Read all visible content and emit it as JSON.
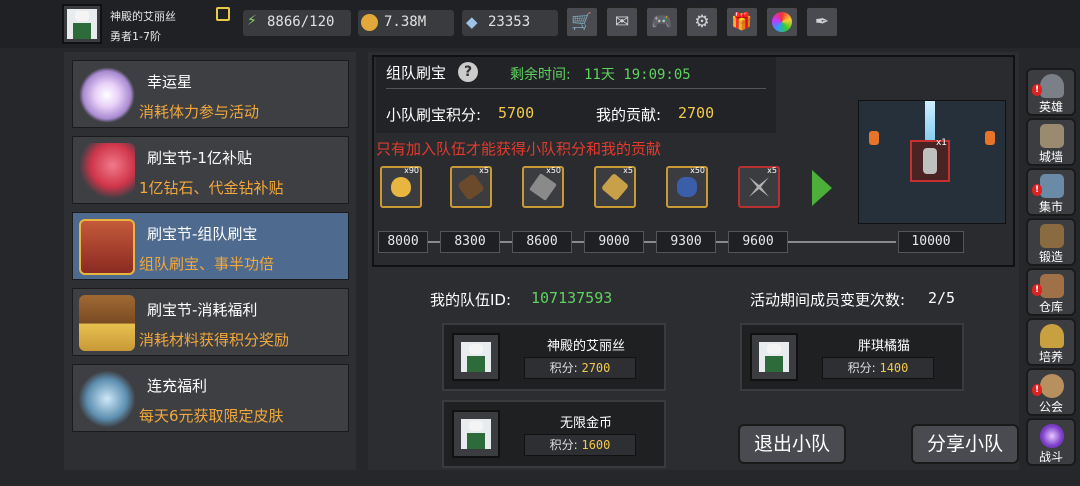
{
  "player": {
    "name": "神殿的艾丽丝",
    "rank": "勇者1-7阶"
  },
  "stats": {
    "energy": "8866/120",
    "gold": "7.38M",
    "gems": "23353"
  },
  "top_icons": [
    "cart-icon",
    "mail-icon",
    "gamepad-icon",
    "gear-icon",
    "gift-icon",
    "color-wheel-icon",
    "feather-icon"
  ],
  "menu": [
    {
      "title": "幸运星",
      "subtitle": "消耗体力参与活动",
      "icon": "lucky-star-icon",
      "color": "#c9b8e0"
    },
    {
      "title": "刷宝节-1亿补贴",
      "subtitle": "1亿钻石、代金钻补贴",
      "icon": "red-gem-icon",
      "color": "#d0354a"
    },
    {
      "title": "刷宝节-组队刷宝",
      "subtitle": "组队刷宝、事半功倍",
      "icon": "chest-icon",
      "color": "#a8372c"
    },
    {
      "title": "刷宝节-消耗福利",
      "subtitle": "消耗材料获得积分奖励",
      "icon": "treasure-chest-icon",
      "color": "#8a5a2a"
    },
    {
      "title": "连充福利",
      "subtitle": "每天6元获取限定皮肤",
      "icon": "crystal-icon",
      "color": "#5d8fb0"
    }
  ],
  "event": {
    "title": "组队刷宝",
    "time_label": "剩余时间:",
    "time_value": "11天 19:09:05",
    "team_score_label": "小队刷宝积分:",
    "team_score": "5700",
    "my_contrib_label": "我的贡献:",
    "my_contrib": "2700",
    "notice": "只有加入队伍才能获得小队积分和我的贡献"
  },
  "rewards": [
    {
      "count": "x90",
      "icon": "golden-egg-icon",
      "color": "#e8b640"
    },
    {
      "count": "x5",
      "icon": "scroll-icon",
      "color": "#6a4a2a"
    },
    {
      "count": "x50",
      "icon": "hammer-icon",
      "color": "#8a8a8a"
    },
    {
      "count": "x5",
      "icon": "staff-icon",
      "color": "#c9a04a"
    },
    {
      "count": "x50",
      "icon": "blue-ore-icon",
      "color": "#3a5fa8"
    },
    {
      "count": "x5",
      "icon": "axes-icon",
      "color": "#b0b0b0"
    }
  ],
  "final_reward": {
    "count": "x1",
    "icon": "hero-card-icon"
  },
  "milestones": [
    "8000",
    "8300",
    "8600",
    "9000",
    "9300",
    "9600",
    "10000"
  ],
  "team": {
    "id_label": "我的队伍ID:",
    "id": "107137593",
    "changes_label": "活动期间成员变更次数:",
    "changes": "2/5",
    "score_label": "积分:",
    "members": [
      {
        "name": "神殿的艾丽丝",
        "score": "2700"
      },
      {
        "name": "胖琪橘猫",
        "score": "1400"
      },
      {
        "name": "无限金币",
        "score": "1600"
      }
    ]
  },
  "buttons": {
    "leave": "退出小队",
    "share": "分享小队"
  },
  "side": [
    {
      "label": "英雄",
      "icon": "helmet-icon",
      "color": "#7a7f88",
      "badge": true
    },
    {
      "label": "城墙",
      "icon": "castle-icon",
      "color": "#9a8a70",
      "badge": false
    },
    {
      "label": "集市",
      "icon": "market-icon",
      "color": "#6a8aa8",
      "badge": true
    },
    {
      "label": "锻造",
      "icon": "anvil-icon",
      "color": "#8a6a40",
      "badge": false
    },
    {
      "label": "仓库",
      "icon": "warehouse-icon",
      "color": "#a07048",
      "badge": true
    },
    {
      "label": "培养",
      "icon": "trophy-icon",
      "color": "#c8a040",
      "badge": false
    },
    {
      "label": "公会",
      "icon": "guild-icon",
      "color": "#b89060",
      "badge": true
    },
    {
      "label": "战斗",
      "icon": "portal-icon",
      "color": "#7a3ac8",
      "badge": false
    }
  ],
  "colors": {
    "accent_orange": "#f2a83b",
    "green": "#5fd35f",
    "yellow": "#f2c94c",
    "red": "#e23b2e",
    "active_menu": "#4f6a8f"
  }
}
